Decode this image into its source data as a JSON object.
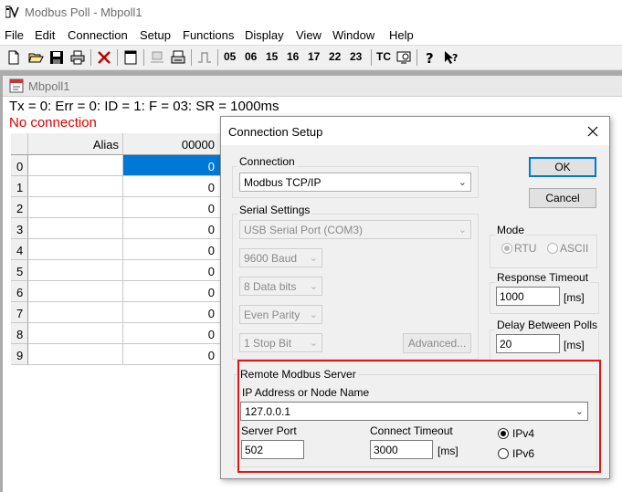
{
  "window": {
    "title": "Modbus Poll - Mbpoll1"
  },
  "menu": [
    "File",
    "Edit",
    "Connection",
    "Setup",
    "Functions",
    "Display",
    "View",
    "Window",
    "Help"
  ],
  "toolbar": {
    "function_codes": [
      "05",
      "06",
      "15",
      "16",
      "17",
      "22",
      "23"
    ],
    "tc_label": "TC"
  },
  "child": {
    "title": "Mbpoll1",
    "status_line": "Tx = 0: Err = 0: ID = 1: F = 03: SR = 1000ms",
    "connection_status": "No connection",
    "grid": {
      "alias_header": "Alias",
      "address_header": "00000",
      "rows": [
        {
          "index": "0",
          "value": "0"
        },
        {
          "index": "1",
          "value": "0"
        },
        {
          "index": "2",
          "value": "0"
        },
        {
          "index": "3",
          "value": "0"
        },
        {
          "index": "4",
          "value": "0"
        },
        {
          "index": "5",
          "value": "0"
        },
        {
          "index": "6",
          "value": "0"
        },
        {
          "index": "7",
          "value": "0"
        },
        {
          "index": "8",
          "value": "0"
        },
        {
          "index": "9",
          "value": "0"
        }
      ]
    }
  },
  "dialog": {
    "title": "Connection Setup",
    "connection_group": "Connection",
    "connection_value": "Modbus TCP/IP",
    "serial_group": "Serial Settings",
    "serial_port": "USB Serial Port (COM3)",
    "baud": "9600 Baud",
    "data_bits": "8 Data bits",
    "parity": "Even Parity",
    "stop_bits": "1 Stop Bit",
    "advanced_label": "Advanced...",
    "ok_label": "OK",
    "cancel_label": "Cancel",
    "mode_group": "Mode",
    "mode_rtu": "RTU",
    "mode_ascii": "ASCII",
    "response_timeout_group": "Response Timeout",
    "response_timeout_value": "1000",
    "ms_unit": "[ms]",
    "delay_group": "Delay Between Polls",
    "delay_value": "20",
    "remote_group": "Remote Modbus Server",
    "ip_label": "IP Address or Node Name",
    "ip_value": "127.0.0.1",
    "server_port_label": "Server Port",
    "server_port_value": "502",
    "connect_timeout_label": "Connect Timeout",
    "connect_timeout_value": "3000",
    "ipv4_label": "IPv4",
    "ipv6_label": "IPv6"
  },
  "colors": {
    "highlight": "#e01515",
    "selected_cell": "#0078d7",
    "error_text": "#e00000"
  }
}
